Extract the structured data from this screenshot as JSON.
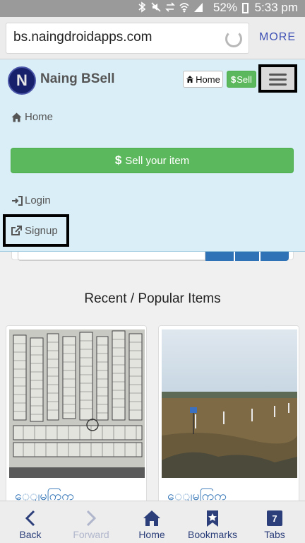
{
  "status_bar": {
    "battery": "52%",
    "time": "5:33 pm"
  },
  "browser": {
    "url": "bs.naingdroidapps.com",
    "more_label": "MORE"
  },
  "navbar": {
    "logo_letter": "N",
    "brand": "Naing BSell",
    "home_button": "Home",
    "sell_button": "Sell",
    "menu": {
      "home": "Home",
      "sell_item": "Sell your item",
      "login": "Login",
      "signup": "Signup"
    }
  },
  "main": {
    "section_title": "Recent / Popular Items",
    "items": [
      {
        "title": "ေျမကြက္"
      },
      {
        "title": "ေျမကြက္"
      }
    ]
  },
  "toolbar": {
    "back": "Back",
    "forward": "Forward",
    "home": "Home",
    "bookmarks": "Bookmarks",
    "tabs": "Tabs",
    "tab_count": "7"
  }
}
